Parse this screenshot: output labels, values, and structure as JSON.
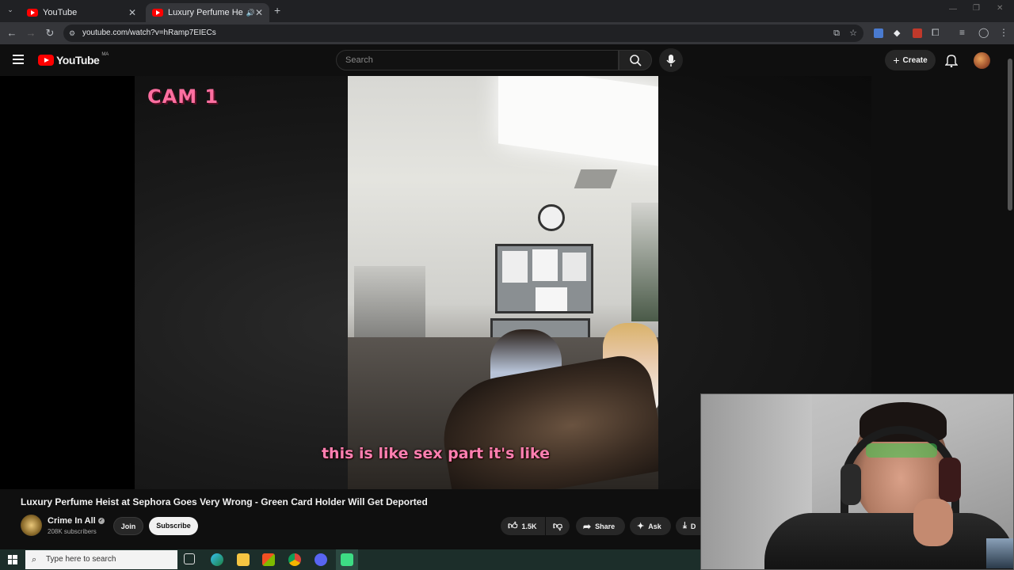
{
  "browser": {
    "tabs": [
      {
        "title": "YouTube"
      },
      {
        "title": "Luxury Perfume Heist at Sep"
      }
    ],
    "url": "youtube.com/watch?v=hRamp7EIECs"
  },
  "youtube": {
    "logo_text": "YouTube",
    "logo_region": "MA",
    "search_placeholder": "Search",
    "create_label": "Create"
  },
  "video": {
    "overlay_label": "CAM 1",
    "caption": "this is like sex part it's like",
    "title": "Luxury Perfume Heist at Sephora Goes Very Wrong - Green Card Holder Will Get Deported",
    "channel": "Crime In All",
    "subscribers": "208K subscribers",
    "join_label": "Join",
    "subscribe_label": "Subscribe",
    "likes": "1.5K",
    "share_label": "Share",
    "ask_label": "Ask",
    "download_label": "D"
  },
  "taskbar": {
    "search_placeholder": "Type here to search"
  },
  "colors": {
    "youtube_red": "#ff0000",
    "caption_pink": "#ff7fb0",
    "cam_label_pink": "#ff6fa0"
  }
}
